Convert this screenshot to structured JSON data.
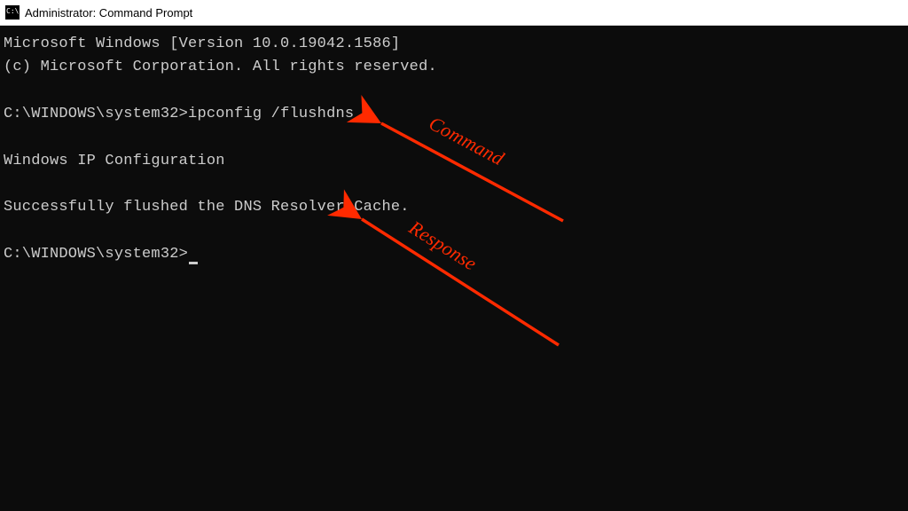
{
  "titlebar": {
    "title": "Administrator: Command Prompt"
  },
  "terminal": {
    "banner1": "Microsoft Windows [Version 10.0.19042.1586]",
    "banner2": "(c) Microsoft Corporation. All rights reserved.",
    "prompt1": "C:\\WINDOWS\\system32>",
    "command": "ipconfig /flushdns",
    "heading": "Windows IP Configuration",
    "response": "Successfully flushed the DNS Resolver Cache.",
    "prompt2": "C:\\WINDOWS\\system32>"
  },
  "annotations": {
    "command_label": "Command",
    "response_label": "Response",
    "color": "#ff2a00"
  }
}
